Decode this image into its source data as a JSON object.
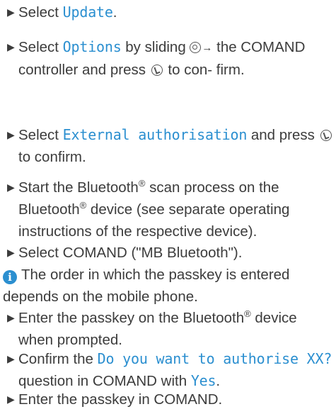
{
  "steps": [
    {
      "id": "s1",
      "parts": [
        "Select ",
        "Update",
        "."
      ]
    },
    {
      "id": "s2",
      "parts": [
        "Select ",
        "Options",
        " by sliding ",
        "",
        " the COMAND controller and press ",
        "",
        " to con- firm."
      ]
    },
    {
      "id": "s3",
      "parts": [
        "Select ",
        "External authorisation",
        " and press ",
        "",
        " to confirm."
      ]
    },
    {
      "id": "s4",
      "parts": [
        "Start the Bluetooth",
        "®",
        " scan process on the Bluetooth",
        "®",
        " device (see separate operating instructions of the respective device)."
      ]
    },
    {
      "id": "s5",
      "parts": [
        "Select COMAND (\"MB Bluetooth\")."
      ]
    },
    {
      "id": "s6",
      "parts": [
        "Enter the passkey on the Bluetooth",
        "®",
        " device when prompted."
      ]
    },
    {
      "id": "s7",
      "parts": [
        "Confirm the ",
        "Do you want to authorise XX?",
        " question in COMAND with ",
        "Yes",
        "."
      ]
    },
    {
      "id": "s8",
      "parts": [
        "Enter the passkey in COMAND."
      ]
    }
  ],
  "note": {
    "icon": "i",
    "text": "The order in which the passkey is entered depends on the mobile phone."
  },
  "icons": {
    "bullet": "▶",
    "controller": "controller-slide-icon",
    "arrow": "→",
    "press": "press-controller-icon"
  },
  "colors": {
    "accent": "#2b8fd0",
    "text": "#3c3c3c"
  }
}
